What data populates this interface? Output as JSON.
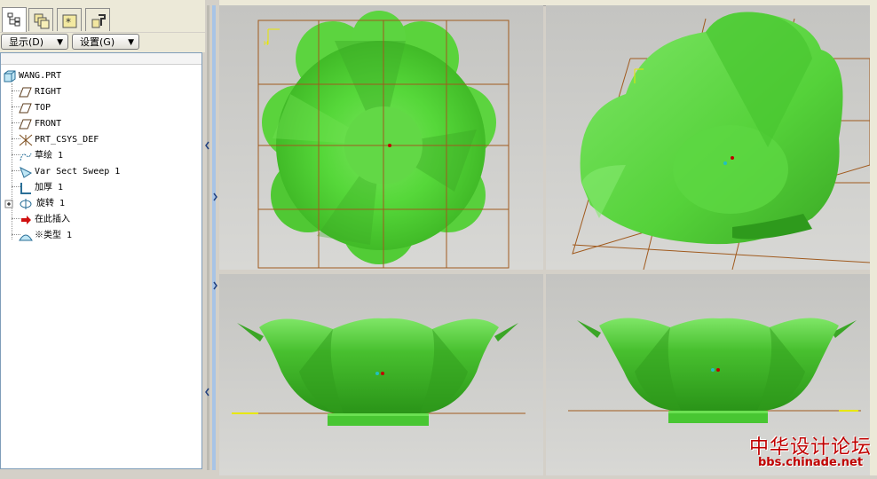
{
  "panel_tabs": [
    {
      "icon": "model-tree-icon",
      "active": true
    },
    {
      "icon": "layers-icon",
      "active": false
    },
    {
      "icon": "favorites-icon",
      "active": false
    },
    {
      "icon": "tools-icon",
      "active": false
    }
  ],
  "buttons": {
    "display_label": "显示(D)",
    "settings_label": "设置(G)"
  },
  "model_tree": {
    "items": [
      {
        "label": "WANG.PRT",
        "icon": "part-icon"
      },
      {
        "label": "RIGHT",
        "icon": "datum-plane-icon"
      },
      {
        "label": "TOP",
        "icon": "datum-plane-icon"
      },
      {
        "label": "FRONT",
        "icon": "datum-plane-icon"
      },
      {
        "label": "PRT_CSYS_DEF",
        "icon": "coordinate-system-icon"
      },
      {
        "label": "草绘 1",
        "icon": "sketch-icon"
      },
      {
        "label": "Var Sect Sweep 1",
        "icon": "sweep-icon"
      },
      {
        "label": "加厚 1",
        "icon": "thicken-icon"
      },
      {
        "label": "旋转 1",
        "icon": "revolve-icon",
        "expandable": true
      },
      {
        "label": "在此插入",
        "icon": "insert-here-arrow-icon"
      },
      {
        "label": "※类型 1",
        "icon": "style-icon"
      }
    ]
  },
  "viewports": [
    {
      "name": "top-view"
    },
    {
      "name": "isometric-view"
    },
    {
      "name": "front-view"
    },
    {
      "name": "side-view"
    }
  ],
  "watermark": {
    "chinese": "中华设计论坛",
    "url": "bbs.chinade.net"
  },
  "colors": {
    "model_green": "#4fd83a",
    "datum_brown": "#a05a1e",
    "viewport_bg": "#cfcfcc"
  }
}
